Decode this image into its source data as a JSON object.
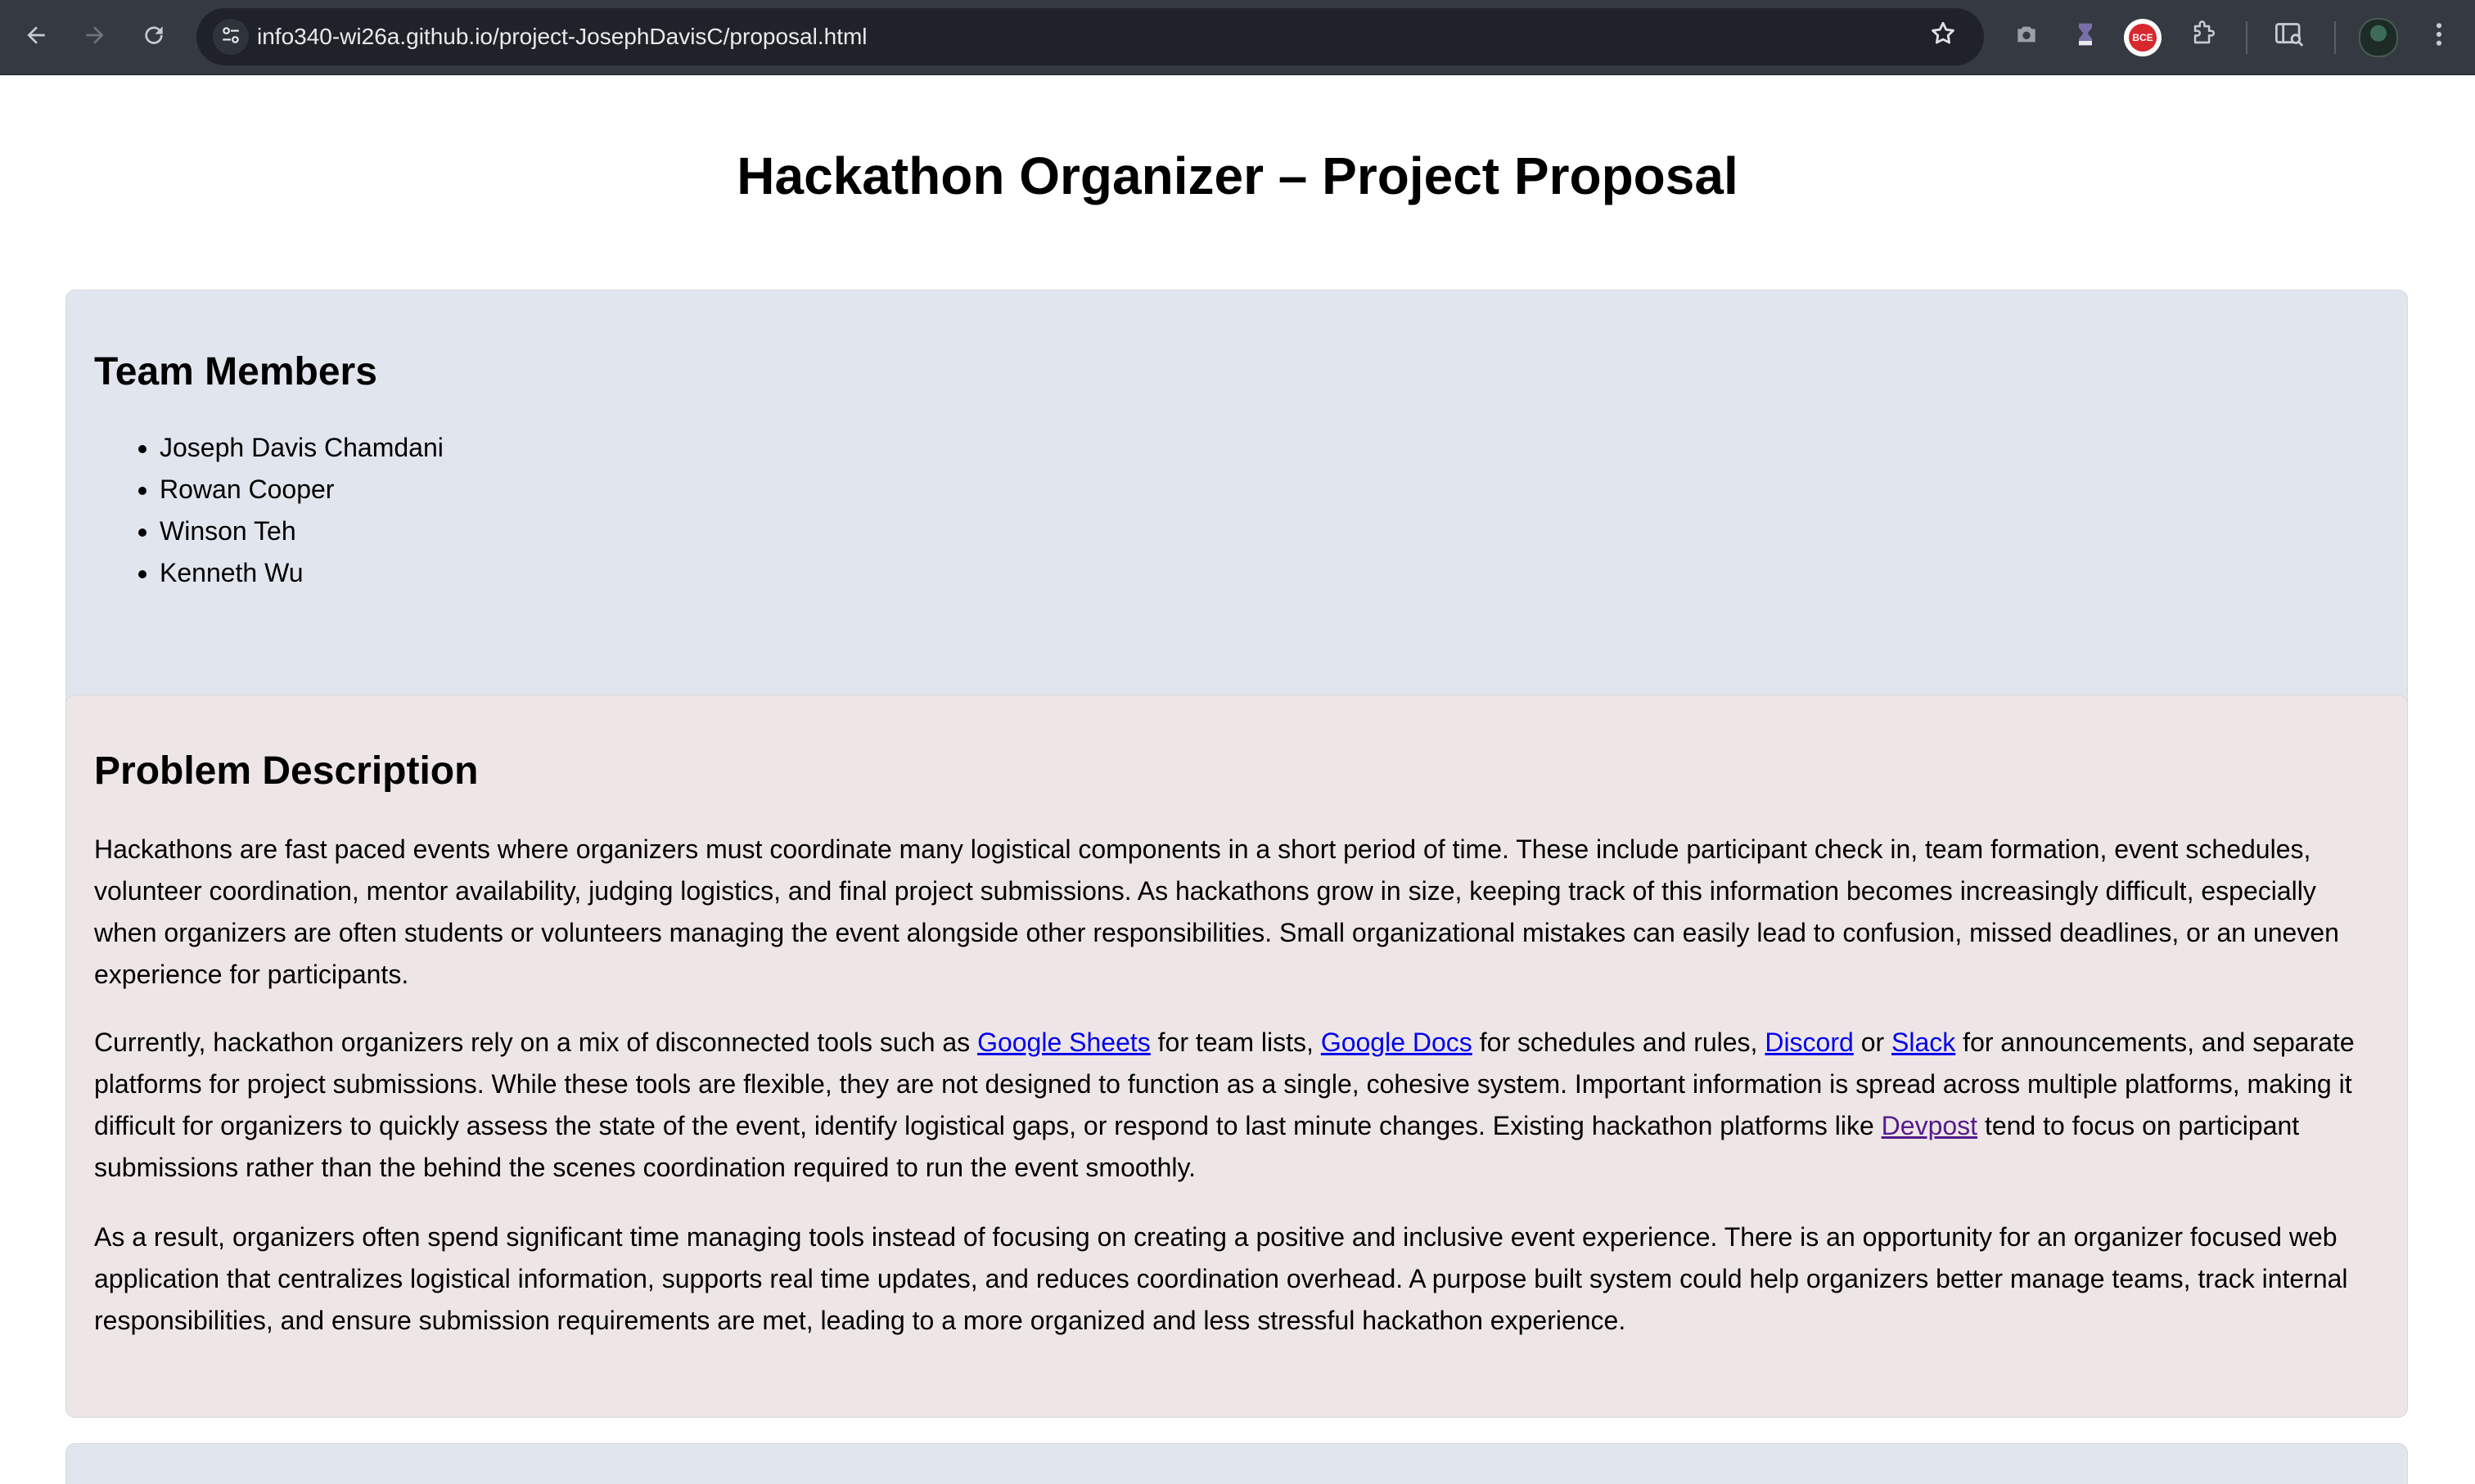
{
  "browser": {
    "url": "info340-wi26a.github.io/project-JosephDavisC/proposal.html",
    "icons": {
      "back": "arrow-left-icon",
      "forward": "arrow-right-icon",
      "reload": "reload-icon",
      "site_info": "tune-icon",
      "bookmark": "star-icon",
      "screenshot": "camera-icon",
      "extension_1": "hourglass-icon",
      "extension_2": "red-badge-extension",
      "extensions": "puzzle-icon",
      "side_panel": "side-panel-search-icon",
      "profile": "avatar",
      "menu": "kebab-menu-icon"
    },
    "extension_badge_text": "BCE",
    "colors": {
      "chrome_bg": "#353a42",
      "omnibox_bg": "#1f2329"
    }
  },
  "page": {
    "title": "Hackathon Organizer – Project Proposal",
    "team": {
      "heading": "Team Members",
      "members": [
        "Joseph Davis Chamdani",
        "Rowan Cooper",
        "Winson Teh",
        "Kenneth Wu"
      ]
    },
    "problem": {
      "heading": "Problem Description",
      "p1": "Hackathons are fast paced events where organizers must coordinate many logistical components in a short period of time. These include participant check in, team formation, event schedules, volunteer coordination, mentor availability, judging logistics, and final project submissions. As hackathons grow in size, keeping track of this information becomes increasingly difficult, especially when organizers are often students or volunteers managing the event alongside other responsibilities. Small organizational mistakes can easily lead to confusion, missed deadlines, or an uneven experience for participants.",
      "p2": {
        "t1": "Currently, hackathon organizers rely on a mix of disconnected tools such as ",
        "link_sheets": "Google Sheets",
        "t2": " for team lists, ",
        "link_docs": "Google Docs",
        "t3": " for schedules and rules, ",
        "link_discord": "Discord",
        "t4": " or ",
        "link_slack": "Slack",
        "t5": " for announcements, and separate platforms for project submissions. While these tools are flexible, they are not designed to function as a single, cohesive system. Important information is spread across multiple platforms, making it difficult for organizers to quickly assess the state of the event, identify logistical gaps, or respond to last minute changes. Existing hackathon platforms like ",
        "link_devpost": "Devpost",
        "t6": " tend to focus on participant submissions rather than the behind the scenes coordination required to run the event smoothly."
      },
      "p3": "As a result, organizers often spend significant time managing tools instead of focusing on creating a positive and inclusive event experience. There is an opportunity for an organizer focused web application that centralizes logistical information, supports real time updates, and reduces coordination overhead. A purpose built system could help organizers better manage teams, track internal responsibilities, and ensure submission requirements are met, leading to a more organized and less stressful hackathon experience."
    },
    "colors": {
      "team_card_bg": "#e1e5ee",
      "problem_card_bg": "#eee6e6",
      "link": "#0000ee",
      "visited_link": "#551a8b"
    }
  }
}
